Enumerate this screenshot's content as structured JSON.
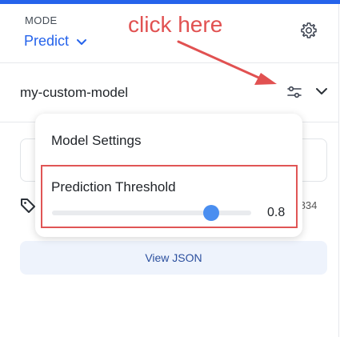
{
  "header": {
    "mode_label": "MODE",
    "mode_value": "Predict"
  },
  "model": {
    "name": "my-custom-model"
  },
  "popover": {
    "title": "Model Settings",
    "threshold_label": "Prediction Threshold",
    "threshold_value": "0.8",
    "threshold_fraction": 0.8
  },
  "result": {
    "score_text": ".834"
  },
  "actions": {
    "view_json": "View JSON"
  },
  "annotation": {
    "text": "click here",
    "color": "#e15151"
  },
  "colors": {
    "accent": "#2563eb",
    "slider_thumb": "#4a8ef0",
    "highlight_border": "#e05555"
  },
  "icons": [
    "gear-icon",
    "chevron-down-icon",
    "sliders-icon",
    "tag-icon",
    "arrow-annotation"
  ]
}
